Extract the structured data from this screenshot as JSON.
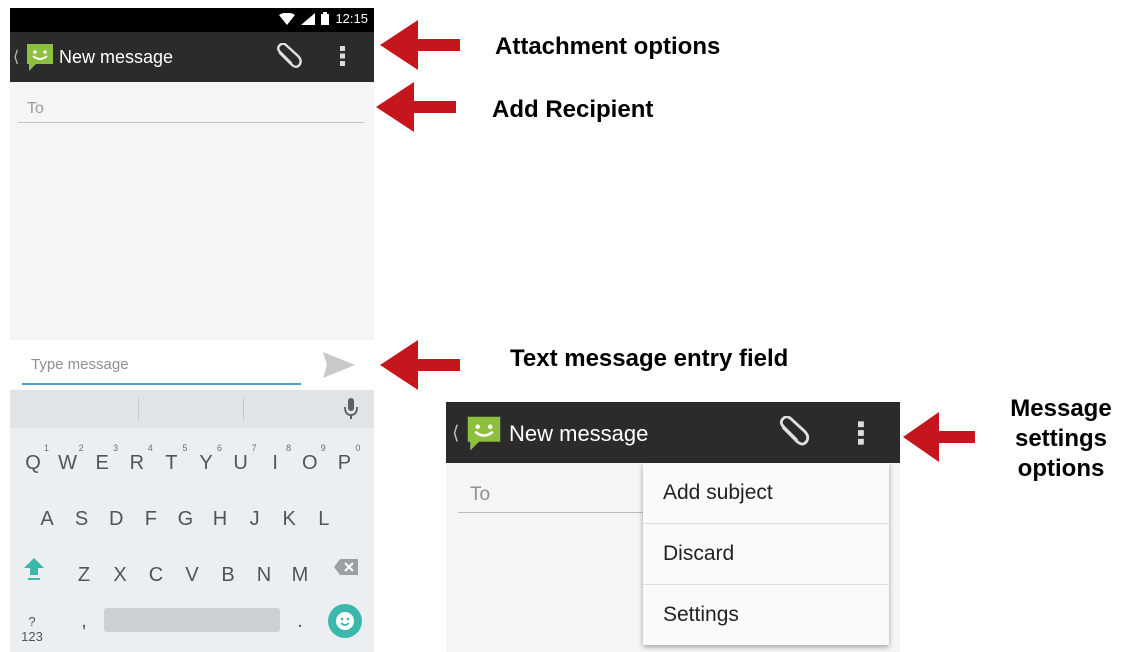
{
  "status_bar": {
    "time": "12:15"
  },
  "phone": {
    "title": "New message",
    "to_placeholder": "To",
    "compose_placeholder": "Type message"
  },
  "keyboard": {
    "row1": [
      {
        "key": "Q",
        "hint": "1"
      },
      {
        "key": "W",
        "hint": "2"
      },
      {
        "key": "E",
        "hint": "3"
      },
      {
        "key": "R",
        "hint": "4"
      },
      {
        "key": "T",
        "hint": "5"
      },
      {
        "key": "Y",
        "hint": "6"
      },
      {
        "key": "U",
        "hint": "7"
      },
      {
        "key": "I",
        "hint": "8"
      },
      {
        "key": "O",
        "hint": "9"
      },
      {
        "key": "P",
        "hint": "0"
      }
    ],
    "row2": [
      "A",
      "S",
      "D",
      "F",
      "G",
      "H",
      "J",
      "K",
      "L"
    ],
    "row3": [
      "Z",
      "X",
      "C",
      "V",
      "B",
      "N",
      "M"
    ],
    "symbols_label": "?123",
    "comma": ",",
    "period": "."
  },
  "annotations": {
    "attachment": "Attachment options",
    "recipient": "Add Recipient",
    "text_entry": "Text message entry field",
    "settings_line1": "Message",
    "settings_line2": "settings",
    "settings_line3": "options"
  },
  "inset": {
    "title": "New message",
    "to_placeholder": "To",
    "menu": [
      "Add subject",
      "Discard",
      "Settings"
    ]
  },
  "colors": {
    "action_bar": "#2b2b2b",
    "logo_green": "#8cc03e",
    "arrow_red": "#c4161c",
    "input_underline": "#4d9fd2",
    "emoji_key": "#3bb8ae"
  }
}
